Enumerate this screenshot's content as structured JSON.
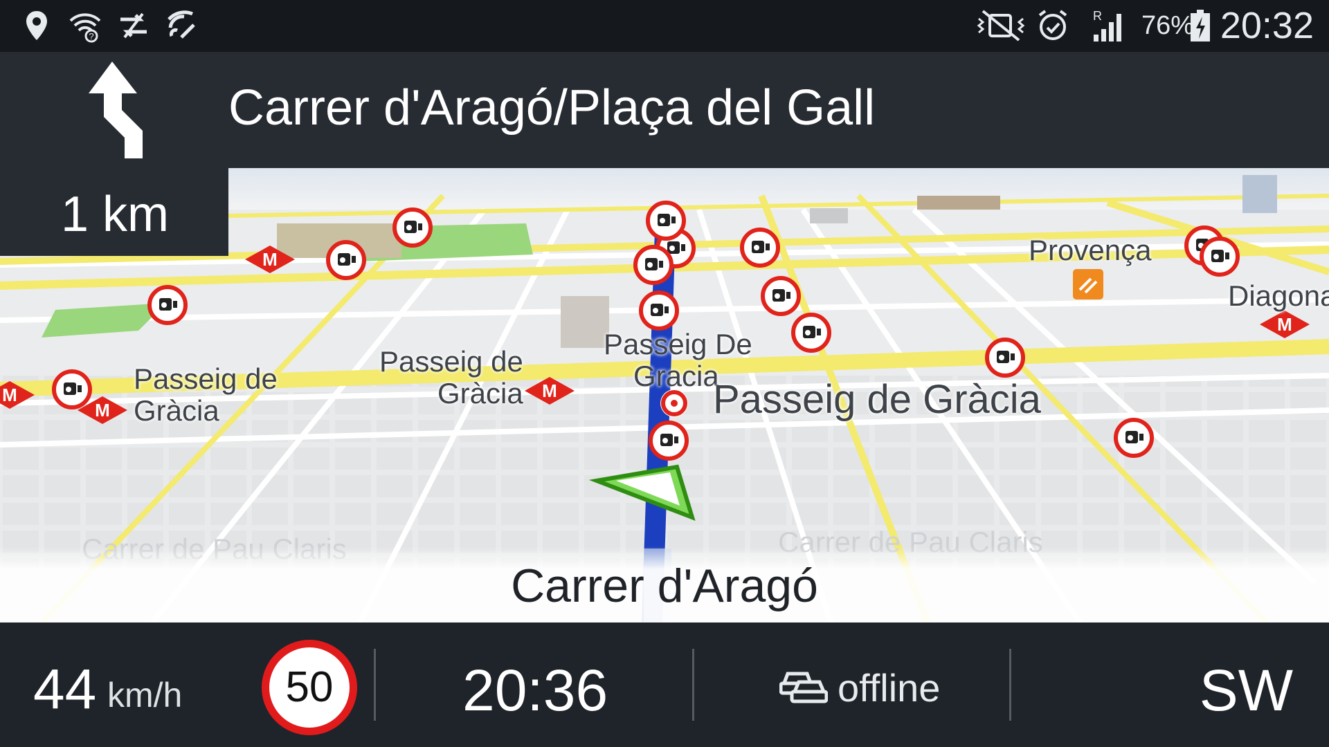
{
  "status_bar": {
    "icons": [
      "location-pin-icon",
      "wifi-question-icon",
      "swap-arrows-icon",
      "nfc-icon",
      "mute-vibrate-icon",
      "alarm-clock-icon",
      "signal-roaming-icon",
      "battery-charging-icon"
    ],
    "battery_percent": "76%",
    "roaming": "R",
    "time": "20:32"
  },
  "instruction": {
    "next_street": "Carrer d'Aragó/Plaça del Gall",
    "distance": "1 km",
    "maneuver_icon": "keep-left-arrow-icon"
  },
  "map": {
    "labels": [
      {
        "text": "Passeig de",
        "name": "label-passeig-de-gracia-left-1"
      },
      {
        "text": "Gràcia",
        "name": "label-passeig-de-gracia-left-2"
      },
      {
        "text": "Passeig de",
        "name": "label-passeig-de-gracia-center-1"
      },
      {
        "text": "Gràcia",
        "name": "label-passeig-de-gracia-center-2"
      },
      {
        "text": "Passeig De",
        "name": "label-passeig-de-gracia-route-1"
      },
      {
        "text": "Gracia",
        "name": "label-passeig-de-gracia-route-2"
      },
      {
        "text": "Passeig  de  Gràcia",
        "name": "label-passeig-de-gracia-main"
      },
      {
        "text": "Provença",
        "name": "label-provenca"
      },
      {
        "text": "Diagona",
        "name": "label-diagonal"
      },
      {
        "text": "Carrer  de  Pau  Claris",
        "name": "label-pau-claris-left"
      },
      {
        "text": "Carrer  de  Pau  Claris",
        "name": "label-pau-claris-right"
      }
    ],
    "metro_letter": "M",
    "colors": {
      "route": "#1c3fbf",
      "road": "#f4ec7a",
      "camera_ring": "#e0231b",
      "metro": "#e0231b",
      "vehicle": "#3fb81e"
    }
  },
  "current_street": "Carrer d'Aragó",
  "bottom_bar": {
    "speed": "44",
    "speed_unit": "km/h",
    "speed_limit": "50",
    "eta": "20:36",
    "traffic_status": "offline",
    "heading": "SW"
  }
}
